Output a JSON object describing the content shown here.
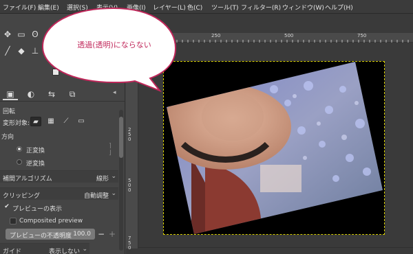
{
  "menubar": {
    "items": [
      "ファイル(F)",
      "編集(E)",
      "選択(S)",
      "表示(V)",
      "画像(I)",
      "レイヤー(L)",
      "色(C)",
      "ツール(T)",
      "フィルター(R)",
      "ウィンドウ(W)",
      "ヘルプ(H)"
    ]
  },
  "toolbox": {
    "tool_icons": [
      "move-icon",
      "rect-select-icon",
      "lasso-icon",
      "paintbrush-icon",
      "eraser-icon",
      "clone-icon"
    ]
  },
  "dock": {
    "tab_icons": [
      "tool-options-icon",
      "device-status-icon",
      "undo-history-icon",
      "images-icon"
    ],
    "tool_name": "回転",
    "transform_label": "変形対象:",
    "transform_targets": [
      "layer-icon",
      "selection-icon",
      "path-icon",
      "image-icon"
    ],
    "direction_label": "方向",
    "direction_normal": "正変換",
    "direction_reverse": "逆変換",
    "interpolation_label": "補間アルゴリズム",
    "interpolation_value": "線形",
    "clipping_label": "クリッピング",
    "clipping_value": "自動調整",
    "show_preview_label": "プレビューの表示",
    "composited_preview_label": "Composited preview",
    "preview_opacity_label": "プレビューの不透明度",
    "preview_opacity_value": "100.0",
    "preview_opacity_fraction": 1.0,
    "guides_label": "ガイド",
    "guides_value": "表示しない"
  },
  "canvas": {
    "hruler_labels": [
      "250",
      "500",
      "750"
    ],
    "vruler_labels": [
      "2\n5\n0",
      "5\n0\n0",
      "7\n5\n0"
    ],
    "frame_color": "#d8d000"
  },
  "callout": {
    "text": "透過(透明)にならない",
    "border_color": "#c0275a"
  }
}
